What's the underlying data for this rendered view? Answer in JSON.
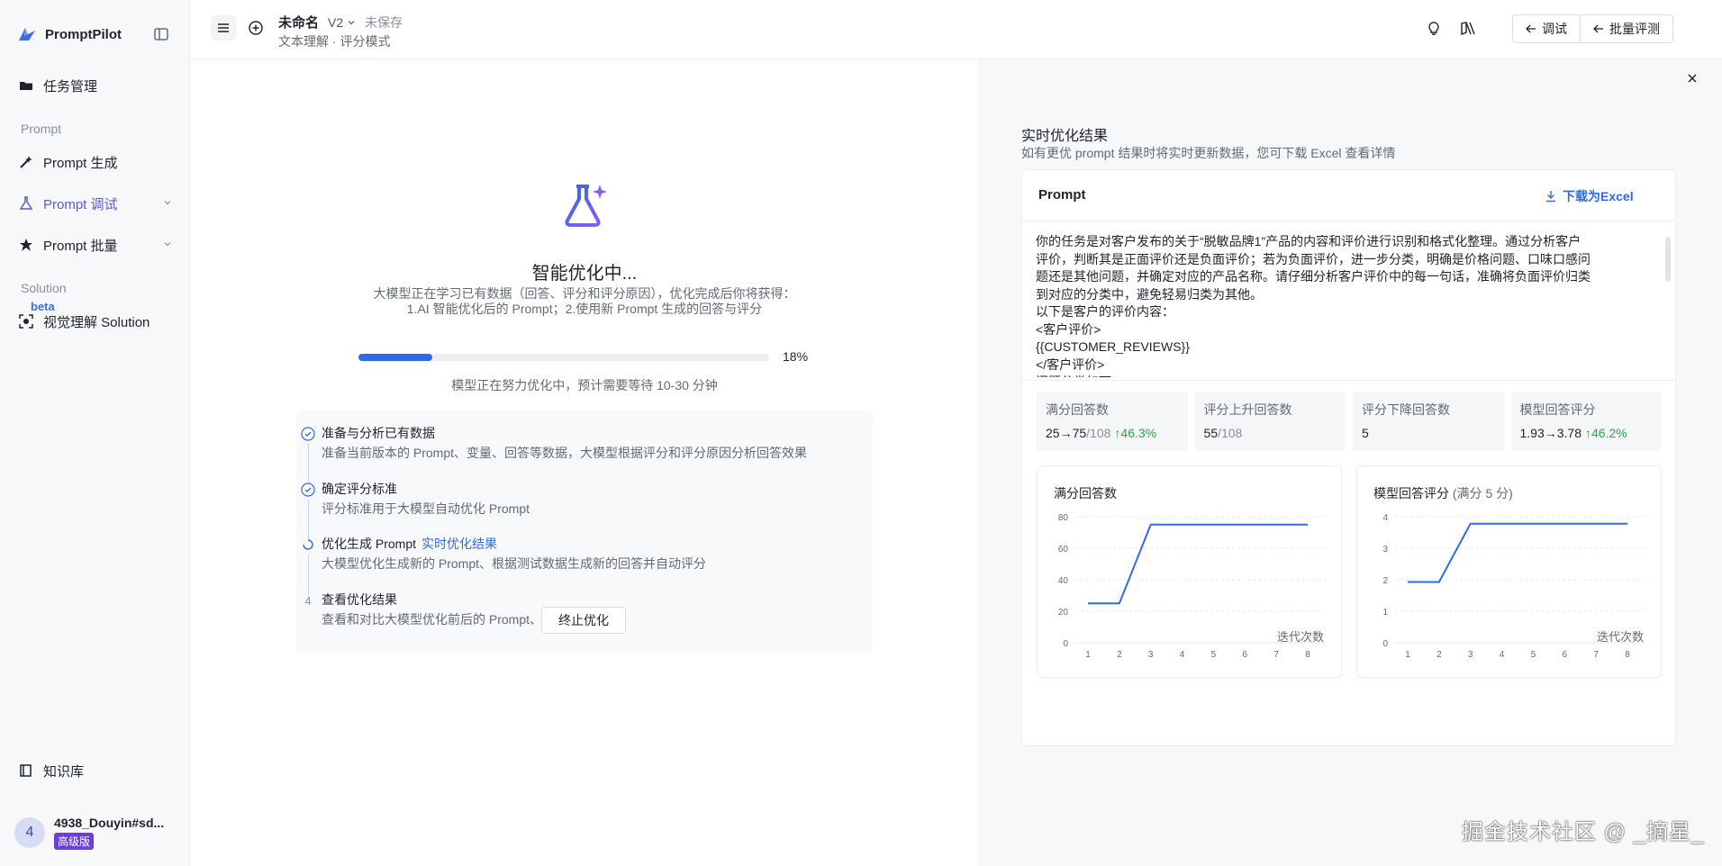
{
  "sidebar": {
    "brand": "PromptPilot",
    "task_mgmt": "任务管理",
    "section_prompt": "Prompt",
    "prompt_gen": "Prompt 生成",
    "prompt_debug": "Prompt 调试",
    "prompt_batch": "Prompt 批量",
    "section_solution": "Solution",
    "beta": "beta",
    "visual_solution": "视觉理解 Solution",
    "knowledge": "知识库",
    "user": {
      "avatar": "4",
      "name": "4938_Douyin#sd...",
      "badge": "高级版"
    }
  },
  "topbar": {
    "name": "未命名",
    "version": "V2",
    "status": "未保存",
    "subtitle": "文本理解 · 评分模式",
    "debug_label": "调试",
    "batch_label": "批量评测"
  },
  "main": {
    "title": "智能优化中...",
    "desc_line1": "大模型正在学习已有数据（回答、评分和评分原因），优化完成后你将获得：",
    "desc_line2": "1.AI 智能优化后的 Prompt；2.使用新 Prompt 生成的回答与评分",
    "progress_percent": 18,
    "progress_label": "18%",
    "progress_note": "模型正在努力优化中，预计需要等待 10-30 分钟",
    "steps": [
      {
        "title": "准备与分析已有数据",
        "desc": "准备当前版本的 Prompt、变量、回答等数据，大模型根据评分和评分原因分析回答效果",
        "status": "done"
      },
      {
        "title": "确定评分标准",
        "desc": "评分标准用于大模型自动优化 Prompt",
        "status": "done"
      },
      {
        "title": "优化生成 Prompt",
        "link": "实时优化结果",
        "desc": "大模型优化生成新的 Prompt、根据测试数据生成新的回答并自动评分",
        "status": "running"
      },
      {
        "title": "查看优化结果",
        "desc": "查看和对比大模型优化前后的 Prompt、回答和评分",
        "status": "pending",
        "num": "4"
      }
    ],
    "stop_label": "终止优化"
  },
  "right": {
    "title": "实时优化结果",
    "subtitle": "如有更优 prompt 结果时将实时更新数据，您可下载 Excel 查看详情",
    "card_title": "Prompt",
    "download_label": "下载为Excel",
    "prompt_lines": [
      "你的任务是对客户发布的关于“脱敏品牌1”产品的内容和评价进行识别和格式化整理。通过分析客户",
      "评价，判断其是正面评价还是负面评价；若为负面评价，进一步分类，明确是价格问题、口味口感问",
      "题还是其他问题，并确定对应的产品名称。请仔细分析客户评价中的每一句话，准确将负面评价归类",
      "到对应的分类中，避免轻易归类为其他。",
      "以下是客户的评价内容：",
      "<客户评价>",
      "{{CUSTOMER_REVIEWS}}",
      "</客户评价>",
      "问题分类如下："
    ],
    "stats": [
      {
        "label": "满分回答数",
        "from": "25",
        "to": "75",
        "total": "/108",
        "change": "↑46.3%"
      },
      {
        "label": "评分上升回答数",
        "value": "55",
        "total": "/108"
      },
      {
        "label": "评分下降回答数",
        "value": "5"
      },
      {
        "label": "模型回答评分",
        "from": "1.93",
        "to": "3.78",
        "change": "↑46.2%"
      }
    ]
  },
  "chart_data": [
    {
      "type": "line",
      "title": "满分回答数",
      "xlabel": "迭代次数",
      "x": [
        1,
        2,
        3,
        4,
        5,
        6,
        7,
        8
      ],
      "values": [
        25,
        25,
        75,
        75,
        75,
        75,
        75,
        75
      ],
      "ylim": [
        0,
        80
      ],
      "yticks": [
        0,
        20,
        40,
        60,
        80
      ],
      "color": "#2f6be3"
    },
    {
      "type": "line",
      "title": "模型回答评分",
      "title_suffix": "(满分 5 分)",
      "xlabel": "迭代次数",
      "x": [
        1,
        2,
        3,
        4,
        5,
        6,
        7,
        8
      ],
      "values": [
        1.93,
        1.93,
        3.78,
        3.78,
        3.78,
        3.78,
        3.78,
        3.78
      ],
      "ylim": [
        0,
        4
      ],
      "yticks": [
        0,
        1,
        2,
        3,
        4
      ],
      "color": "#2f6be3"
    }
  ],
  "watermark": "掘金技术社区 @ _摘星_"
}
